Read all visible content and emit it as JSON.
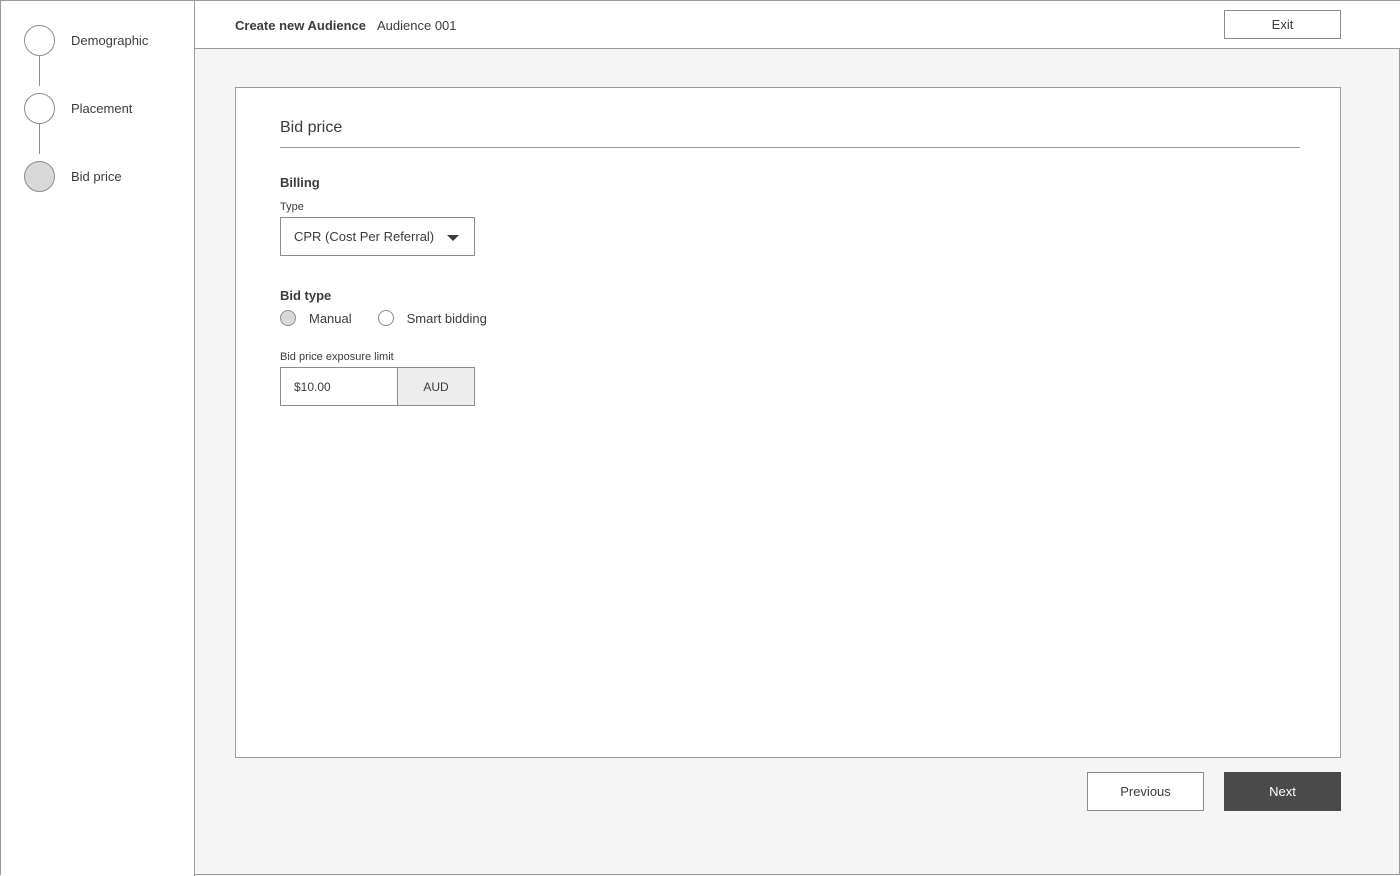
{
  "header": {
    "title": "Create new Audience",
    "subtitle": "Audience 001",
    "exit_label": "Exit"
  },
  "stepper": {
    "steps": [
      {
        "label": "Demographic",
        "active": false
      },
      {
        "label": "Placement",
        "active": false
      },
      {
        "label": "Bid price",
        "active": true
      }
    ]
  },
  "card": {
    "title": "Bid price",
    "billing": {
      "section_label": "Billing",
      "type_label": "Type",
      "type_value": "CPR (Cost Per Referral)"
    },
    "bid_type": {
      "section_label": "Bid type",
      "options": [
        {
          "label": "Manual",
          "selected": true
        },
        {
          "label": "Smart bidding",
          "selected": false
        }
      ]
    },
    "exposure": {
      "label": "Bid price exposure limit",
      "value": "$10.00",
      "currency": "AUD"
    }
  },
  "footer": {
    "previous_label": "Previous",
    "next_label": "Next"
  },
  "colors": {
    "background": "#f5f5f5",
    "border": "#9a9a9a",
    "active_fill": "#d9d9d9",
    "primary_button": "#4a4a4a"
  }
}
